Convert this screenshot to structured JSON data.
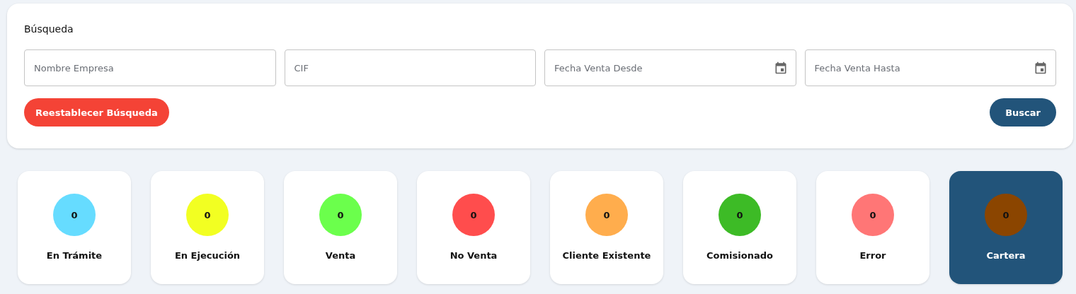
{
  "search": {
    "title": "Búsqueda",
    "fields": [
      {
        "kind": "text",
        "placeholder": "Nombre Empresa"
      },
      {
        "kind": "text",
        "placeholder": "CIF"
      },
      {
        "kind": "date",
        "placeholder": "Fecha Venta Desde"
      },
      {
        "kind": "date",
        "placeholder": "Fecha Venta Hasta"
      }
    ],
    "reset_button": "Reestablecer Búsqueda",
    "search_button": "Buscar"
  },
  "statuses": [
    {
      "label": "En Trámite",
      "count": "0",
      "color": "#66dcff",
      "selected": false
    },
    {
      "label": "En Ejecución",
      "count": "0",
      "color": "#f2ff22",
      "selected": false
    },
    {
      "label": "Venta",
      "count": "0",
      "color": "#6bff4c",
      "selected": false
    },
    {
      "label": "No Venta",
      "count": "0",
      "color": "#ff4d4d",
      "selected": false
    },
    {
      "label": "Cliente Existente",
      "count": "0",
      "color": "#ffad4d",
      "selected": false
    },
    {
      "label": "Comisionado",
      "count": "0",
      "color": "#3dbb26",
      "selected": false
    },
    {
      "label": "Error",
      "count": "0",
      "color": "#ff7676",
      "selected": false
    },
    {
      "label": "Cartera",
      "count": "0",
      "color": "#8b4500",
      "selected": true
    }
  ]
}
